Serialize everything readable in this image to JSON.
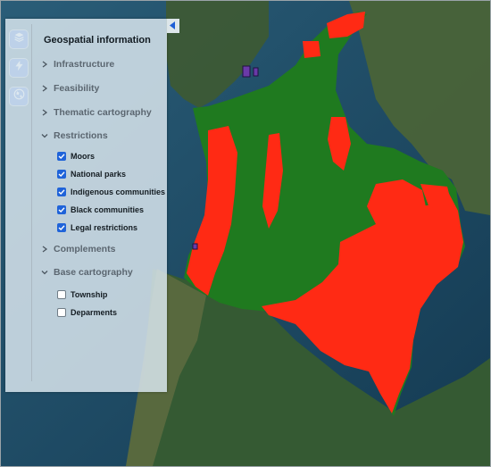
{
  "panel": {
    "title": "Geospatial information",
    "sections": [
      {
        "label": "Infrastructure",
        "expanded": false
      },
      {
        "label": "Feasibility",
        "expanded": false
      },
      {
        "label": "Thematic cartography",
        "expanded": false
      },
      {
        "label": "Restrictions",
        "expanded": true
      },
      {
        "label": "Complements",
        "expanded": false
      },
      {
        "label": "Base cartography",
        "expanded": true
      }
    ],
    "restriction_layers": [
      {
        "label": "Moors",
        "checked": true
      },
      {
        "label": "National parks",
        "checked": true
      },
      {
        "label": "Indigenous communities",
        "checked": true
      },
      {
        "label": "Black communities",
        "checked": true
      },
      {
        "label": "Legal restrictions",
        "checked": true
      }
    ],
    "base_layers": [
      {
        "label": "Township",
        "checked": false
      },
      {
        "label": "Deparments",
        "checked": false
      }
    ]
  },
  "rail": {
    "icons": [
      "layers-icon",
      "lightning-icon",
      "globe-icon"
    ]
  },
  "map": {
    "basemap": "satellite imagery",
    "colors": {
      "ocean": "#1f4a63",
      "land": "#3f5a32",
      "country_fill": "#1f7a1f",
      "restriction_fill": "#ff2a14",
      "accent": "#1e5fd6"
    }
  }
}
